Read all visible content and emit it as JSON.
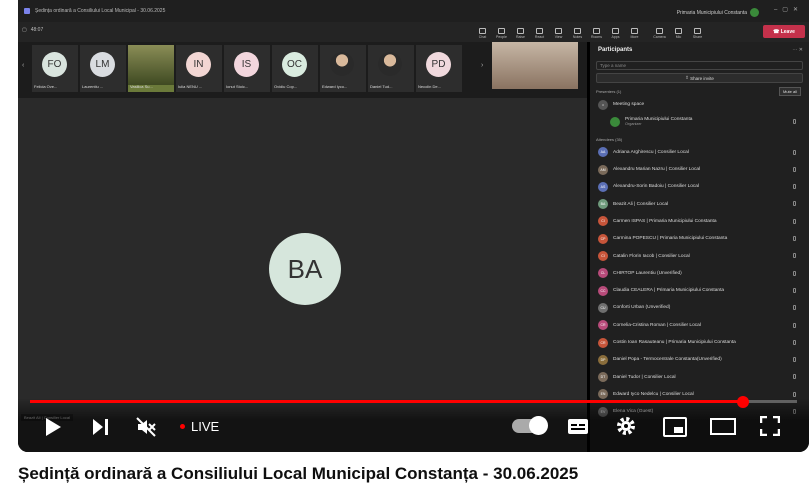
{
  "teams": {
    "window_title": "Ședința ordinară a Consiliului Local Municipal - 30.06.2025",
    "org": "Primaria Municipiului Constanta",
    "timer": "48:07",
    "toolbar": [
      {
        "label": "Chat",
        "icon": "chat-icon"
      },
      {
        "label": "People",
        "icon": "people-icon",
        "count": "36"
      },
      {
        "label": "Raise",
        "icon": "hand-icon"
      },
      {
        "label": "React",
        "icon": "react-icon"
      },
      {
        "label": "View",
        "icon": "view-icon"
      },
      {
        "label": "Notes",
        "icon": "notes-icon"
      },
      {
        "label": "Rooms",
        "icon": "rooms-icon"
      },
      {
        "label": "Apps",
        "icon": "apps-icon"
      },
      {
        "label": "More",
        "icon": "more-icon"
      },
      {
        "label": "Camera",
        "icon": "camera-icon"
      },
      {
        "label": "Mic",
        "icon": "mic-icon"
      },
      {
        "label": "Share",
        "icon": "share-icon"
      }
    ],
    "leave_label": "Leave",
    "thumbnails": [
      {
        "initials": "FO",
        "name": "Felicia Ove...",
        "color": "#d9e4de",
        "kind": "initials"
      },
      {
        "initials": "LM",
        "name": "Laurentiu ...",
        "color": "#d9dce0",
        "kind": "initials"
      },
      {
        "initials": "",
        "name": "Vasilica Su...",
        "color": "",
        "kind": "video"
      },
      {
        "initials": "IN",
        "name": "Iulia NENU ...",
        "color": "#f2d6d3",
        "kind": "initials"
      },
      {
        "initials": "IS",
        "name": "Ionut Stoic...",
        "color": "#f2d6dd",
        "kind": "initials"
      },
      {
        "initials": "OC",
        "name": "Ovidiu Cop...",
        "color": "#d9ebdf",
        "kind": "initials"
      },
      {
        "initials": "",
        "name": "Edward Iyco...",
        "color": "",
        "kind": "photo"
      },
      {
        "initials": "",
        "name": "Daniel Tud...",
        "color": "",
        "kind": "photo"
      },
      {
        "initials": "PD",
        "name": "Necolin De...",
        "color": "#f0d9dd",
        "kind": "initials"
      }
    ],
    "main_avatar": "BA",
    "main_name_tag": "Beazit Ali | Consilier Local",
    "panel": {
      "title": "Participants",
      "search_placeholder": "Type a name",
      "share_invite": "Share invite",
      "presenters_label": "Presenters (1)",
      "mute_all": "Mute all",
      "meeting_space": "Meeting space",
      "organizer_name": "Primaria Municipiului Constanta",
      "organizer_role": "Organizer",
      "attendees_label": "Attendees (35)",
      "attendees": [
        {
          "initials": "AA",
          "name": "Adriana Arghirescu | Consilier Local",
          "color": "#5b6fb5"
        },
        {
          "initials": "AM",
          "name": "Alexandru Marian Nazru | Consilier Local",
          "color": "#7a6a5a"
        },
        {
          "initials": "AS",
          "name": "Alexandru-Sorin Badoiu | Consilier Local",
          "color": "#5b6fb5"
        },
        {
          "initials": "BA",
          "name": "Beazit Ali | Consilier Local",
          "color": "#6f9a7c"
        },
        {
          "initials": "CI",
          "name": "Carmen ISPAS | Primaria Municipiului Constanta",
          "color": "#c7553a"
        },
        {
          "initials": "CP",
          "name": "Carmina POPESCU | Primaria Municipiului Constanta",
          "color": "#c7553a"
        },
        {
          "initials": "CI",
          "name": "Catalin Florin Iacob | Consilier Local",
          "color": "#c7553a"
        },
        {
          "initials": "CL",
          "name": "CHIRTOP Laurentiu (Unverified)",
          "color": "#b84b7a"
        },
        {
          "initials": "CC",
          "name": "Claudia CEALERA | Primaria Municipiului Constanta",
          "color": "#b84b7a"
        },
        {
          "initials": "CU",
          "name": "Conforti Urban (Unverified)",
          "color": "#6f6f6f"
        },
        {
          "initials": "CR",
          "name": "Cornelia-Cristina Roman | Consilier Local",
          "color": "#b84b7a"
        },
        {
          "initials": "CR",
          "name": "Costin Ioan Rasauteanu | Primaria Municipiului Constanta",
          "color": "#c7553a"
        },
        {
          "initials": "DP",
          "name": "Daniel Popa - Termocentrale Constanta(Unverified)",
          "color": "#8a6d3b"
        },
        {
          "initials": "DT",
          "name": "Daniel Tudor | Consilier Local",
          "color": "#7a6a5a"
        },
        {
          "initials": "EN",
          "name": "Edward Iyco Nedelcu | Consilier Local",
          "color": "#7a6a5a"
        },
        {
          "initials": "EV",
          "name": "Elena Vica (Guest)",
          "color": "#6f6f6f"
        }
      ]
    }
  },
  "player": {
    "progress": 0.93,
    "live_label": "LIVE",
    "controls": [
      "play-button",
      "next-button",
      "mute-button",
      "autoplay-toggle",
      "captions-button",
      "settings-button",
      "miniplayer-button",
      "theater-button",
      "fullscreen-button"
    ]
  },
  "video_title": "Ședință ordinară a Consiliului Local Municipal Constanța - 30.06.2025"
}
